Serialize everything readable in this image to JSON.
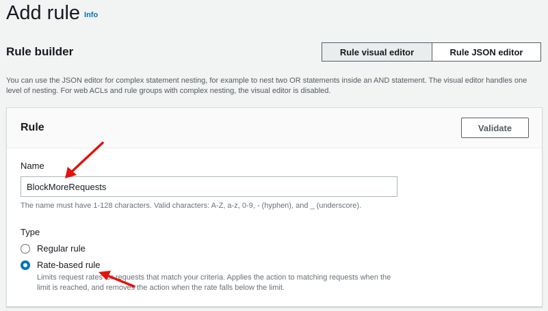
{
  "page": {
    "title": "Add rule",
    "info_link": "Info"
  },
  "rule_builder": {
    "title": "Rule builder",
    "tabs": [
      {
        "label": "Rule visual editor",
        "selected": true
      },
      {
        "label": "Rule JSON editor",
        "selected": false
      }
    ],
    "description": "You can use the JSON editor for complex statement nesting, for example to nest two OR statements inside an AND statement. The visual editor handles one level of nesting. For web ACLs and rule groups with complex nesting, the visual editor is disabled."
  },
  "rule_panel": {
    "title": "Rule",
    "validate_label": "Validate",
    "name": {
      "label": "Name",
      "value": "BlockMoreRequests",
      "hint": "The name must have 1-128 characters. Valid characters: A-Z, a-z, 0-9, - (hyphen), and _ (underscore)."
    },
    "type": {
      "label": "Type",
      "options": [
        {
          "label": "Regular rule",
          "selected": false,
          "description": ""
        },
        {
          "label": "Rate-based rule",
          "selected": true,
          "description": "Limits request rates for requests that match your criteria. Applies the action to matching requests when the limit is reached, and removes the action when the rate falls below the limit."
        }
      ]
    }
  },
  "colors": {
    "accent": "#0073bb",
    "annotation_arrow": "#e3120b"
  }
}
